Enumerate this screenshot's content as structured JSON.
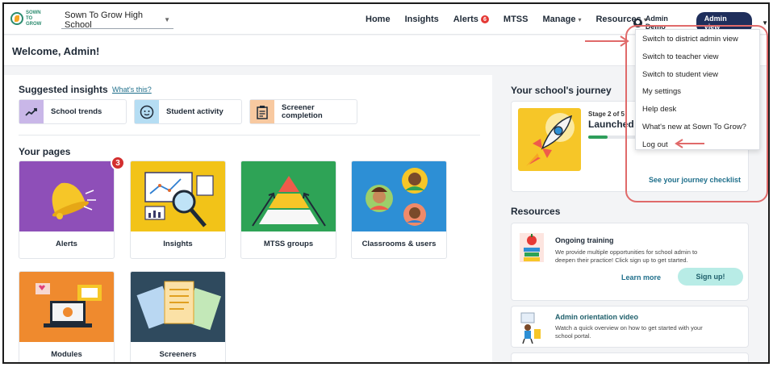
{
  "nav": {
    "logo_text_1": "SOWN",
    "logo_text_2": "TO GROW",
    "school": "Sown To Grow High School",
    "links": [
      "Home",
      "Insights",
      "Alerts",
      "MTSS",
      "Manage",
      "Resources"
    ],
    "alerts_badge": "6",
    "user_name": "Admin Demo",
    "view_label": "Admin view"
  },
  "welcome": "Welcome, Admin!",
  "insights": {
    "title": "Suggested insights",
    "help": "What's this?",
    "items": [
      "School trends",
      "Student activity",
      "Screener\ncompletion"
    ],
    "colors": [
      "#c9b7e8",
      "#b5ddf3",
      "#f8c9a0"
    ]
  },
  "pages": {
    "title": "Your pages",
    "alerts_count": "3",
    "cards": [
      "Alerts",
      "Insights",
      "MTSS groups",
      "Classrooms & users",
      "Modules",
      "Screeners"
    ],
    "colors": [
      "#8e4fb8",
      "#f2c318",
      "#2ea356",
      "#2d8fd5",
      "#ef8a2e",
      "#2f4a5e"
    ]
  },
  "journey": {
    "title": "Your school's journey",
    "stage": "Stage 2 of 5",
    "name": "Launched",
    "progress": 0.4,
    "checklist": "See your journey checklist"
  },
  "resources": {
    "title": "Resources",
    "training_title": "Ongoing training",
    "training_desc": "We provide multiple opportunities for school admin to deepen their practice! Click sign up to get started.",
    "learn_more": "Learn more",
    "sign_up": "Sign up!",
    "video_title": "Admin orientation video",
    "video_desc": "Watch a quick overview on how to get started with your school portal."
  },
  "dropdown": {
    "items": [
      "Switch to district admin view",
      "Switch to teacher view",
      "Switch to student view",
      "My settings",
      "Help desk",
      "What's new at Sown To Grow?",
      "Log out"
    ]
  },
  "annotation_color": "#e06a6a"
}
